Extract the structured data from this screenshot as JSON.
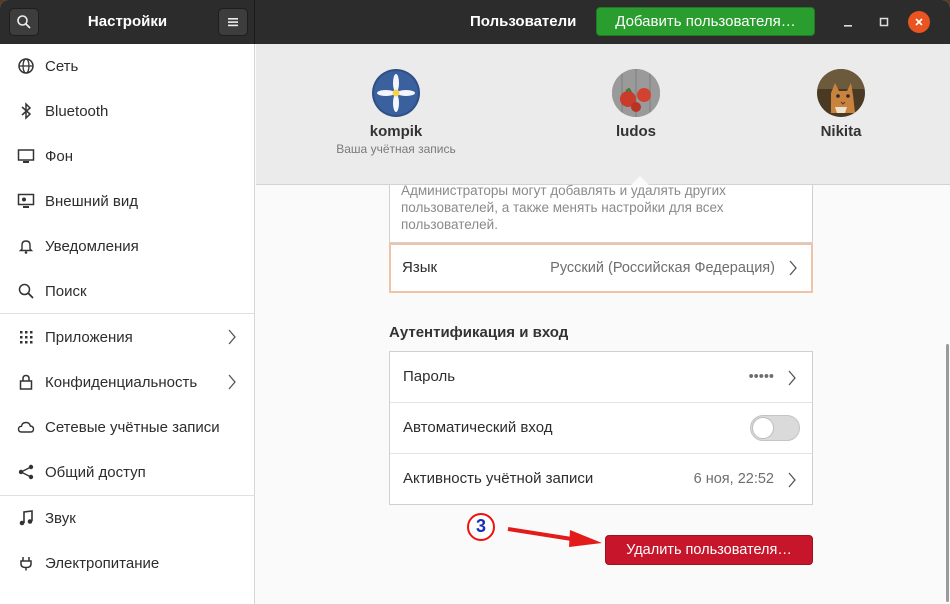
{
  "window": {
    "app_title": "Настройки",
    "page_title": "Пользователи"
  },
  "header": {
    "add_user_label": "Добавить пользователя…"
  },
  "sidebar": {
    "items": [
      {
        "label": "Сеть",
        "icon": "network-icon"
      },
      {
        "label": "Bluetooth",
        "icon": "bluetooth-icon"
      },
      {
        "label": "Фон",
        "icon": "background-icon"
      },
      {
        "label": "Внешний вид",
        "icon": "appearance-icon"
      },
      {
        "label": "Уведомления",
        "icon": "bell-icon"
      },
      {
        "label": "Поиск",
        "icon": "search-icon"
      },
      {
        "label": "Приложения",
        "icon": "apps-grid-icon",
        "has_submenu": true
      },
      {
        "label": "Конфиденциальность",
        "icon": "lock-icon",
        "has_submenu": true
      },
      {
        "label": "Сетевые учётные записи",
        "icon": "cloud-icon"
      },
      {
        "label": "Общий доступ",
        "icon": "share-icon"
      },
      {
        "label": "Звук",
        "icon": "music-note-icon"
      },
      {
        "label": "Электропитание",
        "icon": "power-icon"
      }
    ]
  },
  "users": [
    {
      "name": "kompik",
      "subtitle": "Ваша учётная запись"
    },
    {
      "name": "ludos",
      "subtitle": ""
    },
    {
      "name": "Nikita",
      "subtitle": ""
    }
  ],
  "account": {
    "admin_description": "Администраторы могут добавлять и удалять других пользователей, а также менять настройки для всех пользователей.",
    "language_label": "Язык",
    "language_value": "Русский (Российская Федерация)",
    "auth_section_title": "Аутентификация и вход",
    "password_label": "Пароль",
    "password_value": "•••••",
    "autologin_label": "Автоматический вход",
    "autologin_enabled": false,
    "activity_label": "Активность учётной записи",
    "activity_value": "6 ноя, 22:52",
    "delete_label": "Удалить пользователя…"
  },
  "annotation": {
    "step_number": "3"
  },
  "colors": {
    "accent_green": "#2a9d2f",
    "danger_red": "#c7162b",
    "header_dark": "#2c2c2c",
    "close_orange": "#e95420"
  }
}
